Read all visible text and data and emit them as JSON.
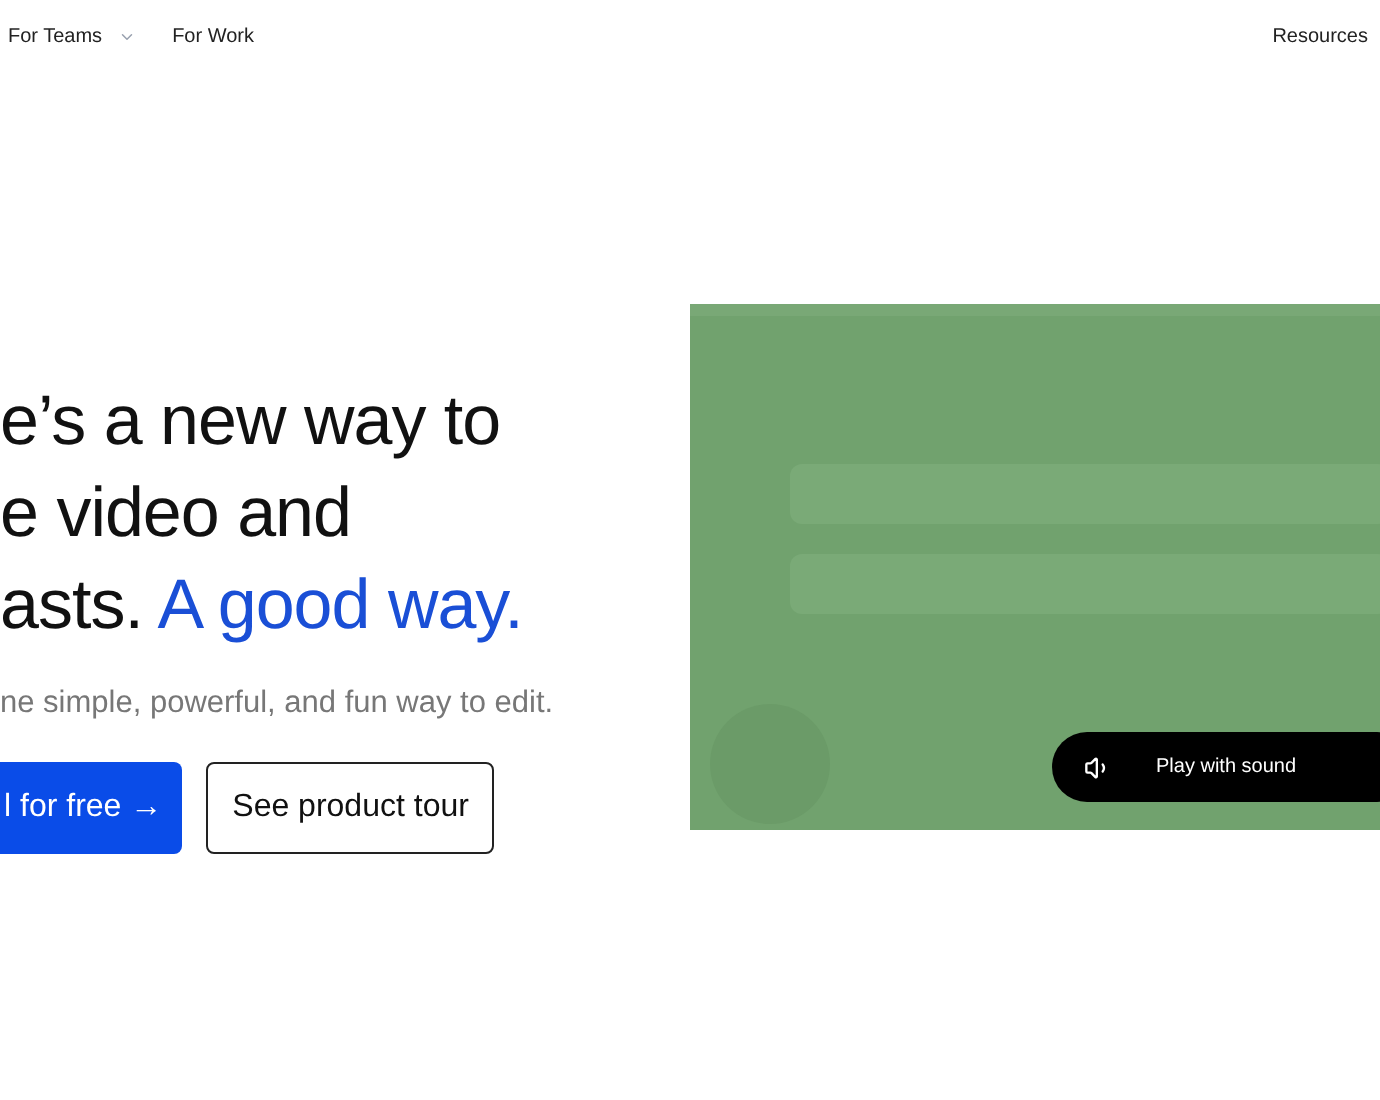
{
  "nav": {
    "left": [
      {
        "label": "For Teams",
        "dropdown": true
      },
      {
        "label": "For Work",
        "dropdown": false
      }
    ],
    "right": [
      {
        "label": "Resources",
        "dropdown": false
      }
    ]
  },
  "hero": {
    "headline": [
      [
        {
          "text": "e’s a new way to",
          "accent": false
        }
      ],
      [
        {
          "text": "e video and",
          "accent": false
        }
      ],
      [
        {
          "text": "asts.",
          "accent": false
        },
        {
          "text": "A good way.",
          "accent": true
        }
      ]
    ],
    "subtitle": "ne simple, powerful, and fun way to edit.",
    "buttons": [
      {
        "label": "l for free →",
        "kind": "primary"
      },
      {
        "label": "See product tour",
        "kind": "secondary"
      }
    ]
  },
  "video": {
    "kind": "picture",
    "sound_button": "Play with sound"
  }
}
